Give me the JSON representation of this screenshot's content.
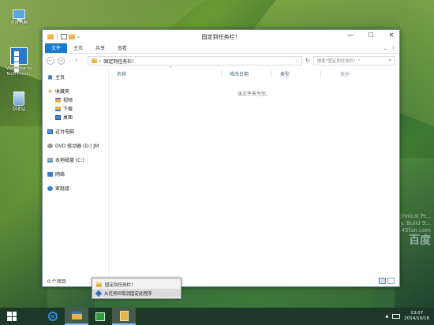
{
  "desktop": {
    "icons": [
      {
        "label": "这台电脑"
      },
      {
        "label": "Welcome to Tech Previ..."
      },
      {
        "label": "回收站"
      }
    ],
    "watermark": {
      "line1": "Windows Technical Pr...",
      "line2": "Evaluation copy. Build 9...",
      "site": "45fan.com",
      "brand": "百度"
    }
  },
  "window": {
    "title": "固定到任务栏！",
    "controls": {
      "minimize": "—",
      "maximize": "☐",
      "close": "✕"
    },
    "ribbon": {
      "tabs": [
        "文件",
        "主页",
        "共享",
        "查看"
      ],
      "expand_glyph": "⌄",
      "help_glyph": "?"
    },
    "address": {
      "back": "←",
      "forward": "→",
      "recent": "⌄",
      "up": "↑",
      "separator": "›",
      "path": "固定到任务栏！",
      "dropdown": "⌄",
      "refresh": "↻"
    },
    "search": {
      "placeholder": "搜索\"固定到任务栏！\"",
      "glyph": "⌕"
    },
    "nav": {
      "items": [
        {
          "label": "主页",
          "icon": "home-icon"
        },
        {
          "label": "收藏夹",
          "icon": "star-icon"
        },
        {
          "label": "视频",
          "icon": "video-folder-icon"
        },
        {
          "label": "下载",
          "icon": "downloads-folder-icon"
        },
        {
          "label": "桌面",
          "icon": "desktop-folder-icon"
        },
        {
          "label": "这台电脑",
          "icon": "computer-icon"
        },
        {
          "label": "DVD 驱动器 (D:) JM",
          "icon": "dvd-drive-icon"
        },
        {
          "label": "本地磁盘 (C:)",
          "icon": "local-disk-icon"
        },
        {
          "label": "网络",
          "icon": "network-icon"
        },
        {
          "label": "家庭组",
          "icon": "homegroup-icon"
        }
      ]
    },
    "columns": {
      "name": "名称",
      "date": "修改日期",
      "type": "类型",
      "size": "大小",
      "sort_glyph": "^"
    },
    "empty_text": "该文件夹为空。",
    "status": "0 个项目"
  },
  "jumplist": {
    "items": [
      {
        "label": "固定到任务栏！",
        "icon": "folder-icon"
      },
      {
        "label": "从任务栏取消固定此程序",
        "icon": "unpin-icon"
      }
    ]
  },
  "taskbar": {
    "clock_time": "13:07",
    "clock_date": "2014/10/18",
    "tray_glyph": "▲"
  }
}
